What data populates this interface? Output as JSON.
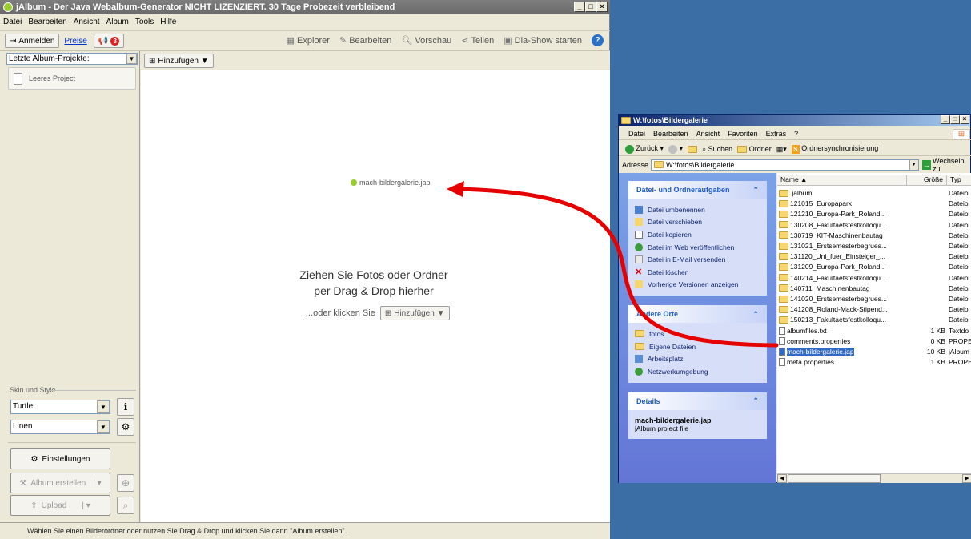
{
  "jalbum": {
    "title": "jAlbum - Der Java Webalbum-Generator NICHT LIZENZIERT. 30 Tage Probezeit verbleibend",
    "menu": [
      "Datei",
      "Bearbeiten",
      "Ansicht",
      "Album",
      "Tools",
      "Hilfe"
    ],
    "login_label": "Anmelden",
    "prices_link": "Preise",
    "notify_count": "3",
    "tools": {
      "explorer": "Explorer",
      "edit": "Bearbeiten",
      "preview": "Vorschau",
      "share": "Teilen",
      "slideshow": "Dia-Show starten"
    },
    "recent_projects_select": "Letzte Album-Projekte:",
    "empty_project": "Leeres Project",
    "add_button": "Hinzufügen ▼",
    "skin_section": "Skin und Style",
    "skin_value": "Turtle",
    "style_value": "Linen",
    "settings_button": "Einstellungen",
    "make_album_button": "Album erstellen",
    "upload_button": "Upload",
    "drop_file": "mach-bildergalerie.jap",
    "drop_text_1": "Ziehen Sie Fotos oder Ordner",
    "drop_text_2": "per Drag & Drop hierher",
    "or_click": "...oder klicken Sie",
    "status": "Wählen Sie einen Bilderordner oder nutzen Sie Drag & Drop und klicken Sie dann \"Album erstellen\"."
  },
  "explorer": {
    "title": "W:\\fotos\\Bildergalerie",
    "menu": [
      "Datei",
      "Bearbeiten",
      "Ansicht",
      "Favoriten",
      "Extras",
      "?"
    ],
    "back": "Zurück",
    "search": "Suchen",
    "folders": "Ordner",
    "sync": "Ordnersynchronisierung",
    "address_label": "Adresse",
    "address_value": "W:\\fotos\\Bildergalerie",
    "go": "Wechseln zu",
    "tasks_title": "Datei- und Ordneraufgaben",
    "tasks": [
      "Datei umbenennen",
      "Datei verschieben",
      "Datei kopieren",
      "Datei im Web veröffentlichen",
      "Datei in E-Mail versenden",
      "Datei löschen",
      "Vorherige Versionen anzeigen"
    ],
    "places_title": "Andere Orte",
    "places": [
      "fotos",
      "Eigene Dateien",
      "Arbeitsplatz",
      "Netzwerkumgebung"
    ],
    "details_title": "Details",
    "details_name": "mach-bildergalerie.jap",
    "details_type": "jAlbum project file",
    "columns": {
      "name": "Name",
      "size": "Größe",
      "type": "Typ"
    },
    "files": [
      {
        "name": ".jalbum",
        "size": "",
        "type": "Dateio",
        "folder": true
      },
      {
        "name": "121015_Europapark",
        "size": "",
        "type": "Dateio",
        "folder": true
      },
      {
        "name": "121210_Europa-Park_Roland...",
        "size": "",
        "type": "Dateio",
        "folder": true
      },
      {
        "name": "130208_Fakultaetsfestkolloqu...",
        "size": "",
        "type": "Dateio",
        "folder": true
      },
      {
        "name": "130719_KIT-Maschinenbautag",
        "size": "",
        "type": "Dateio",
        "folder": true
      },
      {
        "name": "131021_Erstsemesterbegrues...",
        "size": "",
        "type": "Dateio",
        "folder": true
      },
      {
        "name": "131120_Uni_fuer_Einsteiger_...",
        "size": "",
        "type": "Dateio",
        "folder": true
      },
      {
        "name": "131209_Europa-Park_Roland...",
        "size": "",
        "type": "Dateio",
        "folder": true
      },
      {
        "name": "140214_Fakultaetsfestkolloqu...",
        "size": "",
        "type": "Dateio",
        "folder": true
      },
      {
        "name": "140711_Maschinenbautag",
        "size": "",
        "type": "Dateio",
        "folder": true
      },
      {
        "name": "141020_Erstsemesterbegrues...",
        "size": "",
        "type": "Dateio",
        "folder": true
      },
      {
        "name": "141208_Roland-Mack-Stipend...",
        "size": "",
        "type": "Dateio",
        "folder": true
      },
      {
        "name": "150213_Fakultaetsfestkolloqu...",
        "size": "",
        "type": "Dateio",
        "folder": true
      },
      {
        "name": "albumfiles.txt",
        "size": "1 KB",
        "type": "Textdo",
        "folder": false
      },
      {
        "name": "comments.properties",
        "size": "0 KB",
        "type": "PROPE",
        "folder": false
      },
      {
        "name": "mach-bildergalerie.jap",
        "size": "10 KB",
        "type": "jAlbum",
        "folder": false,
        "selected": true
      },
      {
        "name": "meta.properties",
        "size": "1 KB",
        "type": "PROPE",
        "folder": false
      }
    ]
  }
}
